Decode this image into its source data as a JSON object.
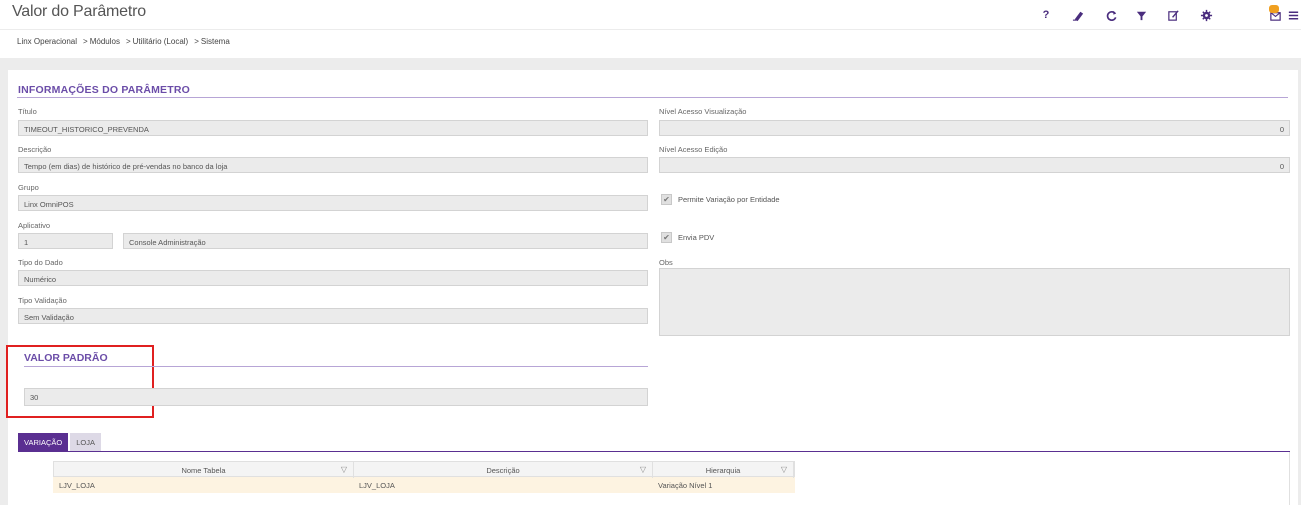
{
  "header": {
    "title": "Valor do Parâmetro",
    "icons": [
      "help-icon",
      "eraser-icon",
      "refresh-icon",
      "filter-icon",
      "edit-icon",
      "settings-icon",
      "mail-icon",
      "menu-icon"
    ],
    "help_glyph": "?",
    "accent_color": "#4a2d7e"
  },
  "breadcrumb": {
    "items": [
      "Linx Operacional",
      "Módulos",
      "Utilitário (Local)",
      "Sistema"
    ],
    "separator": ">"
  },
  "section": {
    "title": "INFORMAÇÕES DO PARÂMETRO"
  },
  "form": {
    "titulo_label": "Título",
    "titulo_value": "TIMEOUT_HISTORICO_PREVENDA",
    "descricao_label": "Descrição",
    "descricao_value": "Tempo (em dias) de histórico de pré-vendas no banco da loja",
    "grupo_label": "Grupo",
    "grupo_value": "Linx OmniPOS",
    "aplicativo_label": "Aplicativo",
    "aplicativo_code": "1",
    "aplicativo_name": "Console Administração",
    "tipo_dado_label": "Tipo do Dado",
    "tipo_dado_value": "Numérico",
    "tipo_validacao_label": "Tipo Validação",
    "tipo_validacao_value": "Sem Validação",
    "nivel_visualizacao_label": "Nível Acesso Visualização",
    "nivel_visualizacao_value": "0",
    "nivel_edicao_label": "Nível Acesso Edição",
    "nivel_edicao_value": "0",
    "permite_variacao_label": "Permite Variação por Entidade",
    "envia_pdv_label": "Envia PDV",
    "obs_label": "Obs"
  },
  "valor_padrao": {
    "title": "VALOR PADRÃO",
    "value": "30",
    "highlight_color": "#e02020"
  },
  "tabs": [
    {
      "label": "VARIAÇÃO",
      "active": true
    },
    {
      "label": "LOJA",
      "active": false
    }
  ],
  "grid": {
    "columns": [
      "Nome Tabela",
      "Descrição",
      "Hierarquia"
    ],
    "rows": [
      [
        "LJV_LOJA",
        "LJV_LOJA",
        "Variação Nível 1"
      ]
    ],
    "filter_glyph": "▽"
  }
}
